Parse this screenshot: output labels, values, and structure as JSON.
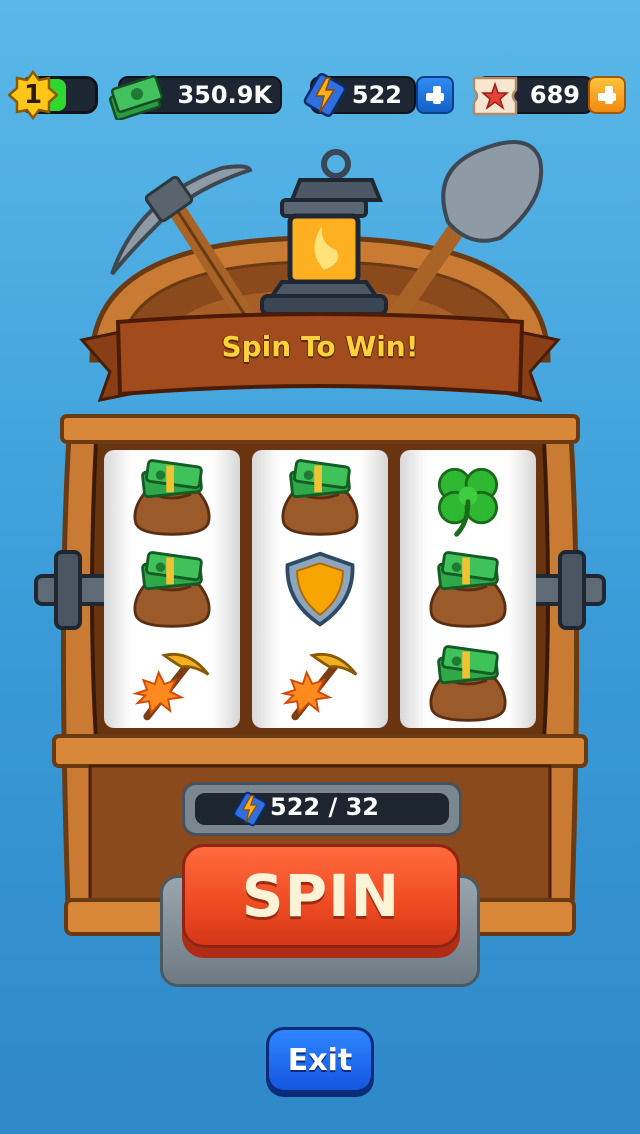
{
  "hud": {
    "level": "1",
    "level_progress": 0.6,
    "cash_value": "350.9K",
    "spins_value": "522",
    "tickets_value": "689"
  },
  "machine": {
    "banner_title": "Spin To Win!",
    "reels": [
      [
        "money-bag-icon",
        "money-bag-icon",
        "pickaxe-icon"
      ],
      [
        "money-bag-icon",
        "shield-icon",
        "pickaxe-icon"
      ],
      [
        "clover-icon",
        "money-bag-icon",
        "money-bag-icon"
      ]
    ],
    "counter_text": "522 / 32",
    "spin_label": "SPIN"
  },
  "exit_label": "Exit",
  "colors": {
    "sky": "#3a9bd8",
    "wood": "#c97b34",
    "spin_red": "#ee4a22",
    "exit_blue": "#1456e0",
    "banner_gold": "#ffd23a"
  }
}
